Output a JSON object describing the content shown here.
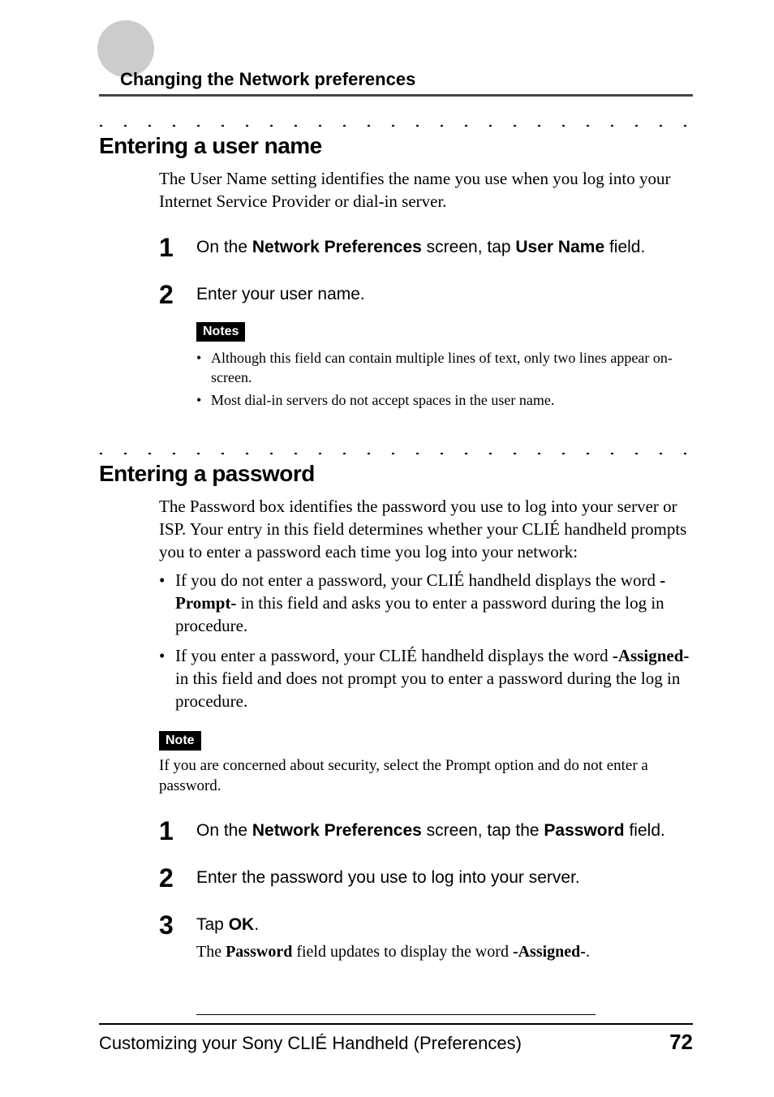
{
  "chapter": "Changing the Network preferences",
  "dots": ". . . . . . . . . . . . . . . . . . . . . . . . . . . . . . . . . . . . . . . . . . . . . . . . . . . . . . . . . . .",
  "section1": {
    "heading": "Entering a user name",
    "intro": "The User Name setting identifies the name you use when you log into your Internet Service Provider or dial-in server.",
    "step1": {
      "num": "1",
      "pre": "On the ",
      "bold1": "Network Preferences",
      "mid": " screen, tap ",
      "bold2": "User Name",
      "post": " field."
    },
    "step2": {
      "num": "2",
      "text": "Enter your user name."
    },
    "notesLabel": "Notes",
    "notes": [
      "Although this field can contain multiple lines of text, only two lines appear on-screen.",
      "Most dial-in servers do not accept spaces in the user name."
    ]
  },
  "section2": {
    "heading": "Entering a password",
    "intro": "The Password box identifies the password you use to log into your server or ISP. Your entry in this field determines whether your CLIÉ handheld prompts you to enter a password each time you log into your network:",
    "bullets": [
      {
        "pre": "If you do not enter a password, your CLIÉ handheld displays the word ",
        "bold": "-Prompt-",
        "post": " in this field and asks you to enter a password during the log in procedure."
      },
      {
        "pre": "If you enter a password, your CLIÉ handheld displays the word ",
        "bold": "-Assigned-",
        "post": " in this field and does not prompt you to enter a password during the log in procedure."
      }
    ],
    "noteLabel": "Note",
    "noteText": "If you are concerned about security, select the Prompt option and do not enter a password.",
    "step1": {
      "num": "1",
      "pre": "On the ",
      "bold1": "Network Preferences",
      "mid": " screen, tap the ",
      "bold2": "Password",
      "post": " field."
    },
    "step2": {
      "num": "2",
      "text": "Enter the password you use to log into your server."
    },
    "step3": {
      "num": "3",
      "pre": "Tap ",
      "bold": "OK",
      "post": ".",
      "subPre": "The ",
      "subBold1": "Password",
      "subMid": " field updates to display the word ",
      "subBold2": "-Assigned-",
      "subPost": "."
    }
  },
  "footer": {
    "title": "Customizing your Sony CLIÉ Handheld (Preferences)",
    "page": "72"
  }
}
